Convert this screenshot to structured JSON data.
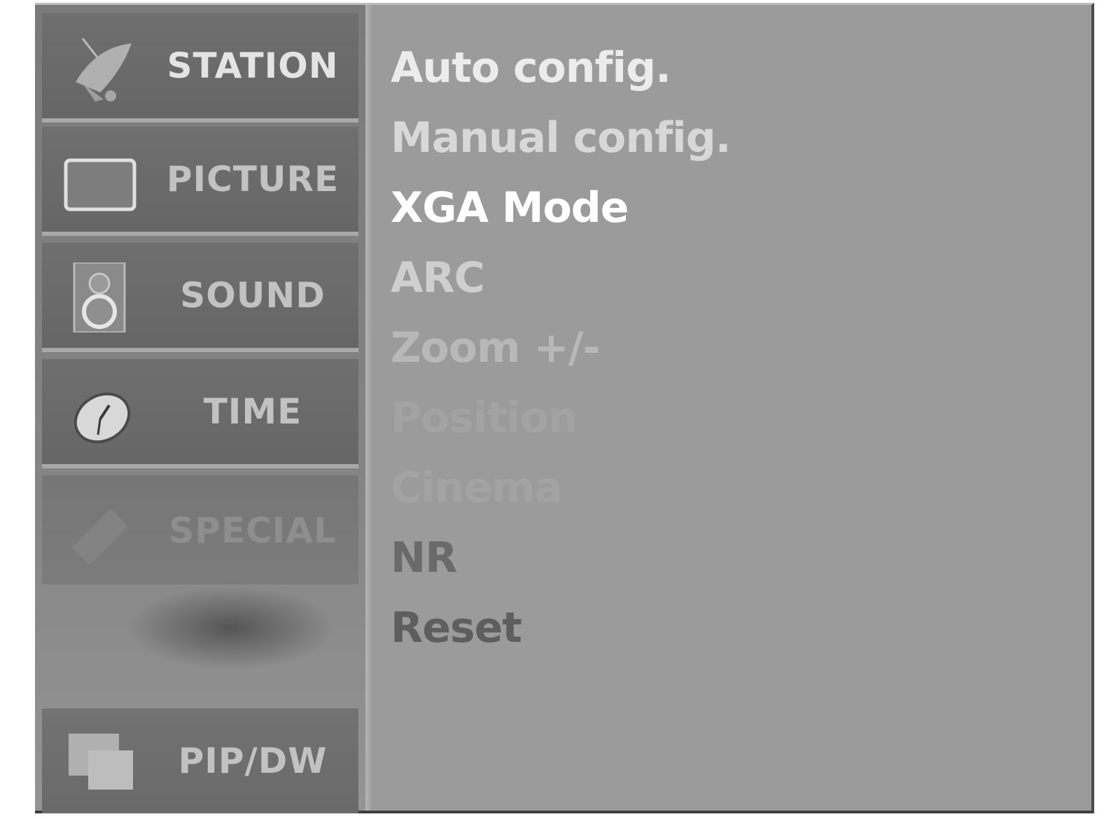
{
  "sidebar": {
    "tabs": [
      {
        "label": "STATION",
        "icon": "satellite-dish-icon"
      },
      {
        "label": "PICTURE",
        "icon": "tv-screen-icon"
      },
      {
        "label": "SOUND",
        "icon": "speaker-icon"
      },
      {
        "label": "TIME",
        "icon": "clock-icon"
      },
      {
        "label": "SPECIAL",
        "icon": "special-icon"
      },
      {
        "label": "PIP/DW",
        "icon": "pip-windows-icon"
      }
    ]
  },
  "menu": {
    "items": [
      {
        "label": "Auto config."
      },
      {
        "label": "Manual config."
      },
      {
        "label": "XGA Mode"
      },
      {
        "label": "ARC"
      },
      {
        "label": "Zoom +/-"
      },
      {
        "label": "Position"
      },
      {
        "label": "Cinema"
      },
      {
        "label": "NR"
      },
      {
        "label": "Reset"
      }
    ]
  }
}
